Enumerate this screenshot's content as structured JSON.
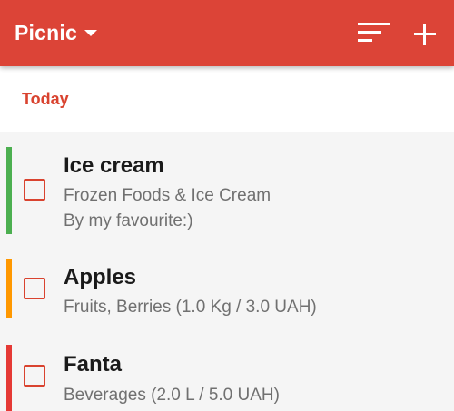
{
  "appbar": {
    "list_title": "Picnic",
    "dropdown_icon": "caret-down-icon",
    "sort_icon": "sort-icon",
    "add_icon": "plus-icon",
    "color": "#dc4437"
  },
  "section": {
    "label": "Today"
  },
  "items": [
    {
      "name": "Ice cream",
      "category": "Frozen Foods & Ice Cream",
      "note": "By my favourite:)",
      "accent": "#4caf50",
      "checked": false
    },
    {
      "name": "Apples",
      "category": "Fruits, Berries (1.0 Kg / 3.0 UAH)",
      "accent": "#ff9800",
      "checked": false
    },
    {
      "name": "Fanta",
      "category": "Beverages (2.0 L / 5.0 UAH)",
      "accent": "#e53935",
      "checked": false
    }
  ]
}
